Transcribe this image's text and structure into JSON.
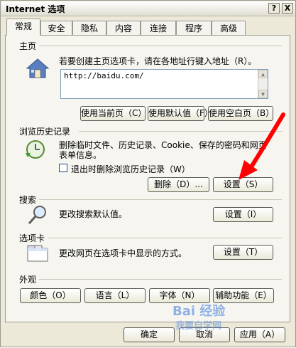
{
  "window": {
    "title": "Internet 选项",
    "help": "?",
    "close": "X"
  },
  "tabs": [
    {
      "label": "常规",
      "active": true
    },
    {
      "label": "安全"
    },
    {
      "label": "隐私"
    },
    {
      "label": "内容"
    },
    {
      "label": "连接"
    },
    {
      "label": "程序"
    },
    {
      "label": "高级"
    }
  ],
  "homepage": {
    "section_label": "主页",
    "description": "若要创建主页选项卡，请在各地址行键入地址（R）。",
    "url": "http://baidu.com/",
    "buttons": {
      "current": "使用当前页（C）",
      "default": "使用默认值（F）",
      "blank": "使用空白页（B）"
    }
  },
  "history": {
    "section_label": "浏览历史记录",
    "description_line1": "删除临时文件、历史记录、Cookie、保存的密码和网页",
    "description_line2": "表单信息。",
    "checkbox_label": "退出时删除浏览历史记录（W）",
    "delete_button": "删除（D）...",
    "settings_button": "设置（S）"
  },
  "search": {
    "section_label": "搜索",
    "description": "更改搜索默认值。",
    "settings_button": "设置（I）"
  },
  "tabs_section": {
    "section_label": "选项卡",
    "description": "更改网页在选项卡中显示的方式。",
    "settings_button": "设置（T）"
  },
  "appearance": {
    "section_label": "外观",
    "buttons": {
      "colors": "颜色（O）",
      "languages": "语言（L）",
      "fonts": "字体（N）",
      "accessibility": "辅助功能（E）"
    }
  },
  "footer": {
    "ok": "确定",
    "cancel": "取消",
    "apply": "应用（A）"
  },
  "watermark": {
    "text": "Bai 经验",
    "sub": "我要自学网"
  },
  "colors": {
    "dialog_bg": "#ece9d8",
    "arrow": "#ff0000"
  }
}
